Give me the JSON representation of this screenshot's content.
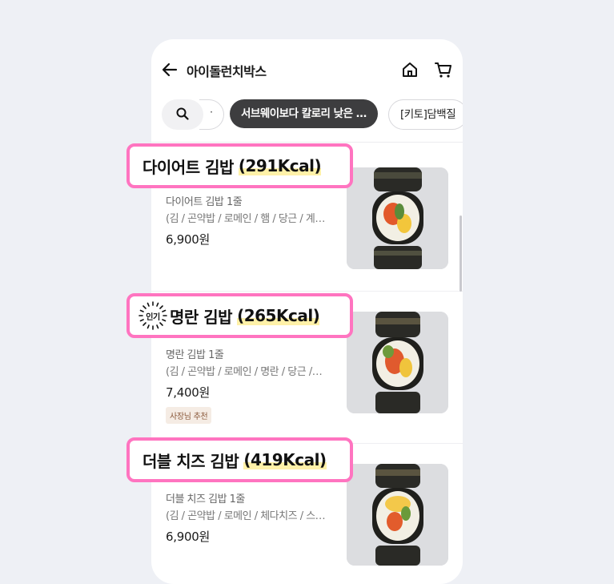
{
  "header": {
    "title": "아이돌런치박스"
  },
  "filters": {
    "dot": "·",
    "active": "서브웨이보다 칼로리 낮은 …",
    "next": "[키토]담백질"
  },
  "items": [
    {
      "callout_name": "다이어트 김밥",
      "callout_kcal": "(291Kcal)",
      "subtitle": "다이어트 김밥 1줄",
      "desc": "(김 / 곤약밥 / 로메인 / 햄 / 당근 / 계…",
      "price": "6,900원"
    },
    {
      "popular_badge": "인기",
      "callout_name": "명란 김밥",
      "callout_kcal": "(265Kcal)",
      "subtitle": "명란 김밥 1줄",
      "desc": "(김 / 곤약밥 / 로메인 / 명란 / 당근 /…",
      "price": "7,400원",
      "badge": "사장님 추천"
    },
    {
      "callout_name": "더블 치즈 김밥",
      "callout_kcal": "(419Kcal)",
      "subtitle": "더블 치즈 김밥 1줄",
      "desc": "(김 / 곤약밥 / 로메인 / 체다치즈 / 스…",
      "price": "6,900원"
    }
  ],
  "colors": {
    "highlight_border": "#ff74c0",
    "kcal_underline": "#fff1a8",
    "active_chip": "#3d3d3f"
  },
  "icons": [
    "back-arrow-icon",
    "home-icon",
    "cart-icon",
    "search-icon"
  ]
}
